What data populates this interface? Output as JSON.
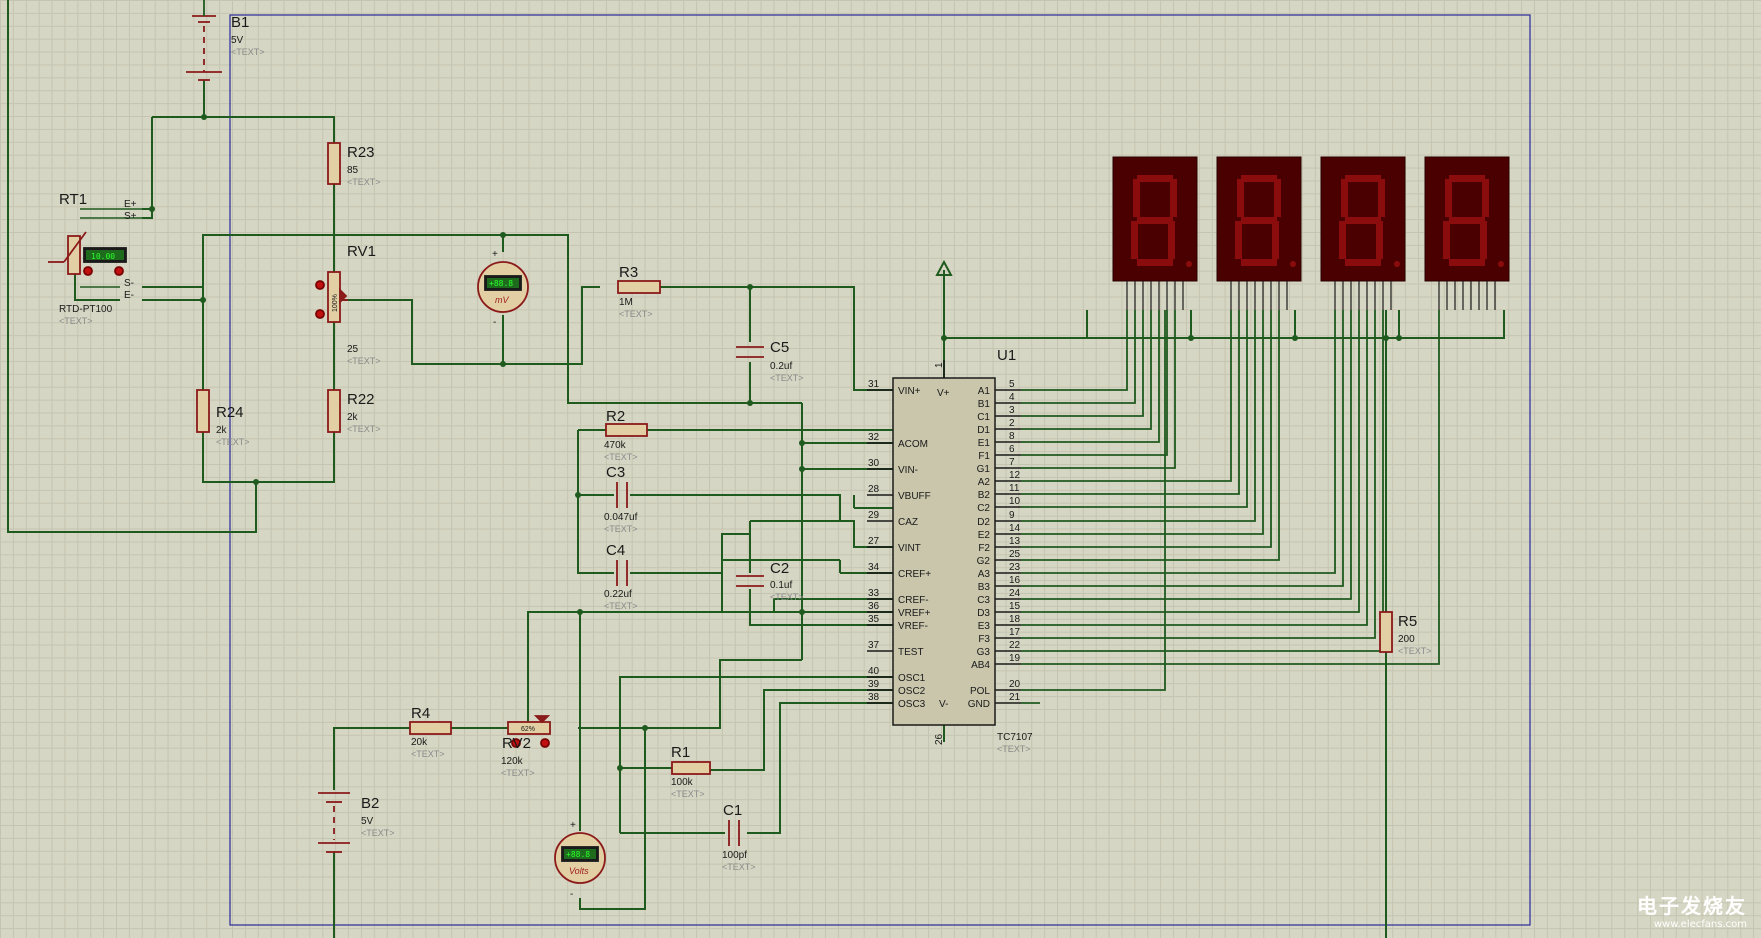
{
  "colors": {
    "background": "#d6d6c4",
    "wire": "#1f5a1f",
    "component": "#8b1a1a",
    "component_fill": "#e2cfa4",
    "ic_fill": "#c9c6ac",
    "sheet_border": "#2a2a9a",
    "display_bg": "#4a0000",
    "display_segment": "#8b0c0c"
  },
  "components": {
    "b1": {
      "ref": "B1",
      "value": "5V",
      "tag": "<TEXT>"
    },
    "b2": {
      "ref": "B2",
      "value": "5V",
      "tag": "<TEXT>"
    },
    "rt1": {
      "ref": "RT1",
      "value": "RTD-PT100",
      "tag": "<TEXT>",
      "reading": "10.00",
      "pins": [
        "E+",
        "S+",
        "S-",
        "E-"
      ]
    },
    "r23": {
      "ref": "R23",
      "value": "85",
      "tag": "<TEXT>"
    },
    "rv1": {
      "ref": "RV1",
      "value": "25",
      "tag": "<TEXT>",
      "percent": "100%"
    },
    "r22": {
      "ref": "R22",
      "value": "2k",
      "tag": "<TEXT>"
    },
    "r24": {
      "ref": "R24",
      "value": "2k",
      "tag": "<TEXT>"
    },
    "mv_meter": {
      "reading": "+88.8",
      "unit": "mV",
      "plus": "+",
      "minus": "-"
    },
    "r3": {
      "ref": "R3",
      "value": "1M",
      "tag": "<TEXT>"
    },
    "c5": {
      "ref": "C5",
      "value": "0.2uf",
      "tag": "<TEXT>"
    },
    "r2": {
      "ref": "R2",
      "value": "470k",
      "tag": "<TEXT>"
    },
    "c3": {
      "ref": "C3",
      "value": "0.047uf",
      "tag": "<TEXT>"
    },
    "c4": {
      "ref": "C4",
      "value": "0.22uf",
      "tag": "<TEXT>"
    },
    "c2": {
      "ref": "C2",
      "value": "0.1uf",
      "tag": "<TEXT>"
    },
    "r4": {
      "ref": "R4",
      "value": "20k",
      "tag": "<TEXT>"
    },
    "rv2": {
      "ref": "RV2",
      "value": "120k",
      "tag": "<TEXT>",
      "percent": "62%"
    },
    "r1": {
      "ref": "R1",
      "value": "100k",
      "tag": "<TEXT>"
    },
    "c1": {
      "ref": "C1",
      "value": "100pf",
      "tag": "<TEXT>"
    },
    "volt_meter": {
      "reading": "+88.8",
      "unit": "Volts",
      "plus": "+",
      "minus": "-"
    },
    "r5": {
      "ref": "R5",
      "value": "200",
      "tag": "<TEXT>"
    },
    "u1": {
      "ref": "U1",
      "part": "TC7107",
      "tag": "<TEXT>",
      "top_pin": "1",
      "bottom_pin": "26",
      "vplus": "V+",
      "vminus": "V-",
      "left_pins": [
        {
          "num": "31",
          "name": "VIN+"
        },
        {
          "num": "32",
          "name": "ACOM"
        },
        {
          "num": "30",
          "name": "VIN-"
        },
        {
          "num": "28",
          "name": "VBUFF"
        },
        {
          "num": "29",
          "name": "CAZ"
        },
        {
          "num": "27",
          "name": "VINT"
        },
        {
          "num": "34",
          "name": "CREF+"
        },
        {
          "num": "33",
          "name": "CREF-"
        },
        {
          "num": "36",
          "name": "VREF+"
        },
        {
          "num": "35",
          "name": "VREF-"
        },
        {
          "num": "37",
          "name": "TEST"
        },
        {
          "num": "40",
          "name": "OSC1"
        },
        {
          "num": "39",
          "name": "OSC2"
        },
        {
          "num": "38",
          "name": "OSC3"
        }
      ],
      "right_pins": [
        {
          "num": "5",
          "name": "A1"
        },
        {
          "num": "4",
          "name": "B1"
        },
        {
          "num": "3",
          "name": "C1"
        },
        {
          "num": "2",
          "name": "D1"
        },
        {
          "num": "8",
          "name": "E1"
        },
        {
          "num": "6",
          "name": "F1"
        },
        {
          "num": "7",
          "name": "G1"
        },
        {
          "num": "12",
          "name": "A2"
        },
        {
          "num": "11",
          "name": "B2"
        },
        {
          "num": "10",
          "name": "C2"
        },
        {
          "num": "9",
          "name": "D2"
        },
        {
          "num": "14",
          "name": "E2"
        },
        {
          "num": "13",
          "name": "F2"
        },
        {
          "num": "25",
          "name": "G2"
        },
        {
          "num": "23",
          "name": "A3"
        },
        {
          "num": "16",
          "name": "B3"
        },
        {
          "num": "24",
          "name": "C3"
        },
        {
          "num": "15",
          "name": "D3"
        },
        {
          "num": "18",
          "name": "E3"
        },
        {
          "num": "17",
          "name": "F3"
        },
        {
          "num": "22",
          "name": "G3"
        },
        {
          "num": "19",
          "name": "AB4"
        }
      ],
      "right_bottom_pins": [
        {
          "num": "20",
          "name": "POL"
        },
        {
          "num": "21",
          "name": "GND"
        }
      ]
    },
    "displays": {
      "count": 4,
      "digit": "8"
    }
  },
  "watermark": {
    "title": "电子发烧友",
    "url": "www.elecfans.com"
  }
}
